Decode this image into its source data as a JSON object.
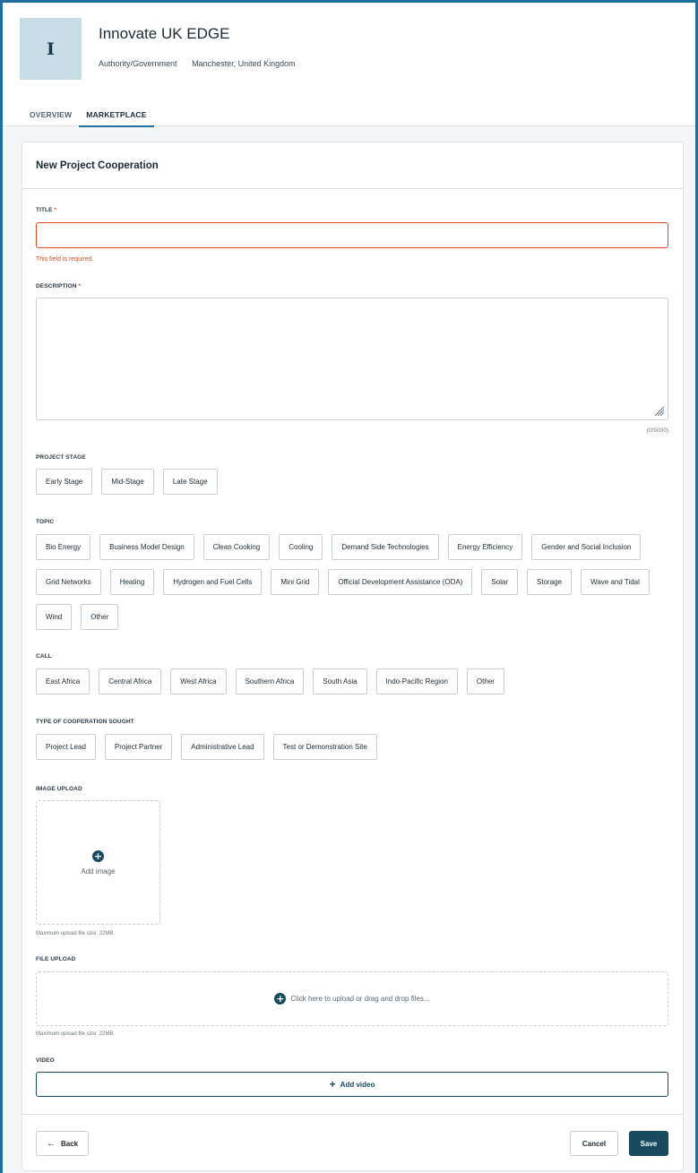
{
  "org": {
    "avatar_letter": "I",
    "name": "Innovate UK EDGE",
    "category": "Authority/Government",
    "location": "Manchester, United Kingdom"
  },
  "tabs": [
    {
      "label": "OVERVIEW",
      "active": false
    },
    {
      "label": "MARKETPLACE",
      "active": true
    }
  ],
  "form": {
    "title": "New Project Cooperation",
    "title_field": {
      "label": "TITLE",
      "required_mark": "*",
      "value": "",
      "error": "This field is required."
    },
    "description_field": {
      "label": "DESCRIPTION",
      "required_mark": "*",
      "value": "",
      "counter": "(0/5000)"
    },
    "project_stage": {
      "label": "PROJECT STAGE",
      "options": [
        "Early Stage",
        "Mid-Stage",
        "Late Stage"
      ]
    },
    "topic": {
      "label": "TOPIC",
      "options": [
        "Bio Energy",
        "Business Model Design",
        "Clean Cooking",
        "Cooling",
        "Demand Side Technologies",
        "Energy Efficiency",
        "Gender and Social Inclusion",
        "Grid Networks",
        "Heating",
        "Hydrogen and Fuel Cells",
        "Mini Grid",
        "Official Development Assistance (ODA)",
        "Solar",
        "Storage",
        "Wave and Tidal",
        "Wind",
        "Other"
      ]
    },
    "call": {
      "label": "CALL",
      "options": [
        "East Africa",
        "Central Africa",
        "West Africa",
        "Southern Africa",
        "South Asia",
        "Indo-Pacific Region",
        "Other"
      ]
    },
    "cooperation_type": {
      "label": "TYPE OF COOPERATION SOUGHT",
      "options": [
        "Project Lead",
        "Project Partner",
        "Administrative Lead",
        "Test or Demonstration Site"
      ]
    },
    "image_upload": {
      "label": "IMAGE UPLOAD",
      "button_text": "Add image",
      "hint": "Maximum upload file size: 22MB."
    },
    "file_upload": {
      "label": "FILE UPLOAD",
      "drop_text": "Click here to upload or drag and drop files...",
      "hint": "Maximum upload file size: 22MB."
    },
    "video": {
      "label": "VIDEO",
      "button_text": "Add video"
    }
  },
  "footer": {
    "back_label": "Back",
    "cancel_label": "Cancel",
    "save_label": "Save"
  },
  "colors": {
    "brand": "#184a62",
    "frame": "#1f6f9e",
    "error": "#e0481f"
  }
}
